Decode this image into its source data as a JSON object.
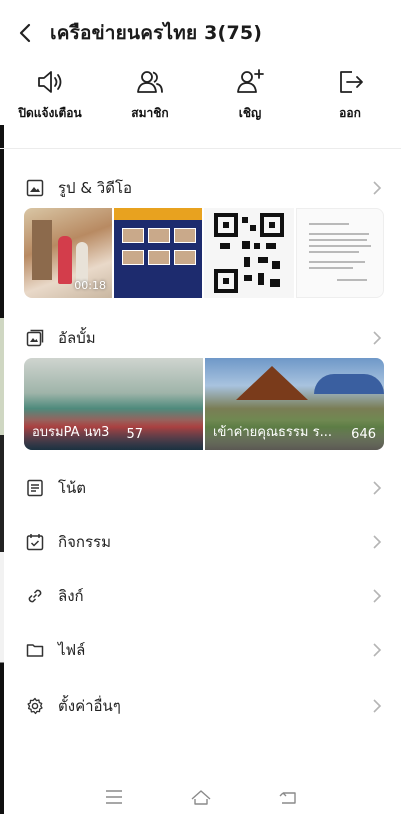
{
  "header": {
    "title": "เครือข่ายนครไทย 3(75)",
    "back_icon": "chevron-left-icon"
  },
  "actions": [
    {
      "label": "ปิดแจ้งเตือน",
      "icon": "speaker-icon"
    },
    {
      "label": "สมาชิก",
      "icon": "members-icon"
    },
    {
      "label": "เชิญ",
      "icon": "invite-icon"
    },
    {
      "label": "ออก",
      "icon": "exit-icon"
    }
  ],
  "sections": {
    "photos": {
      "label": "รูป & วิดีโอ",
      "icon": "photo-icon",
      "video_duration": "00:18"
    },
    "albums": {
      "label": "อัลบั้ม",
      "icon": "album-icon",
      "items": [
        {
          "title": "อบรมPA นท3",
          "count": "57"
        },
        {
          "title": "เข้าค่ายคุณธรรม ร...",
          "count": "646"
        }
      ]
    },
    "notes": {
      "label": "โน้ต",
      "icon": "note-icon"
    },
    "events": {
      "label": "กิจกรรม",
      "icon": "calendar-icon"
    },
    "links": {
      "label": "ลิงก์",
      "icon": "link-icon"
    },
    "files": {
      "label": "ไฟล์",
      "icon": "folder-icon"
    },
    "settings": {
      "label": "ตั้งค่าอื่นๆ",
      "icon": "gear-icon"
    }
  },
  "system_nav": {
    "icons": [
      "menu-icon",
      "home-icon",
      "back-icon"
    ]
  },
  "colors": {
    "accent_text": "#1b1b1b",
    "chevron": "#b5b5b5",
    "divider": "#ececec"
  }
}
